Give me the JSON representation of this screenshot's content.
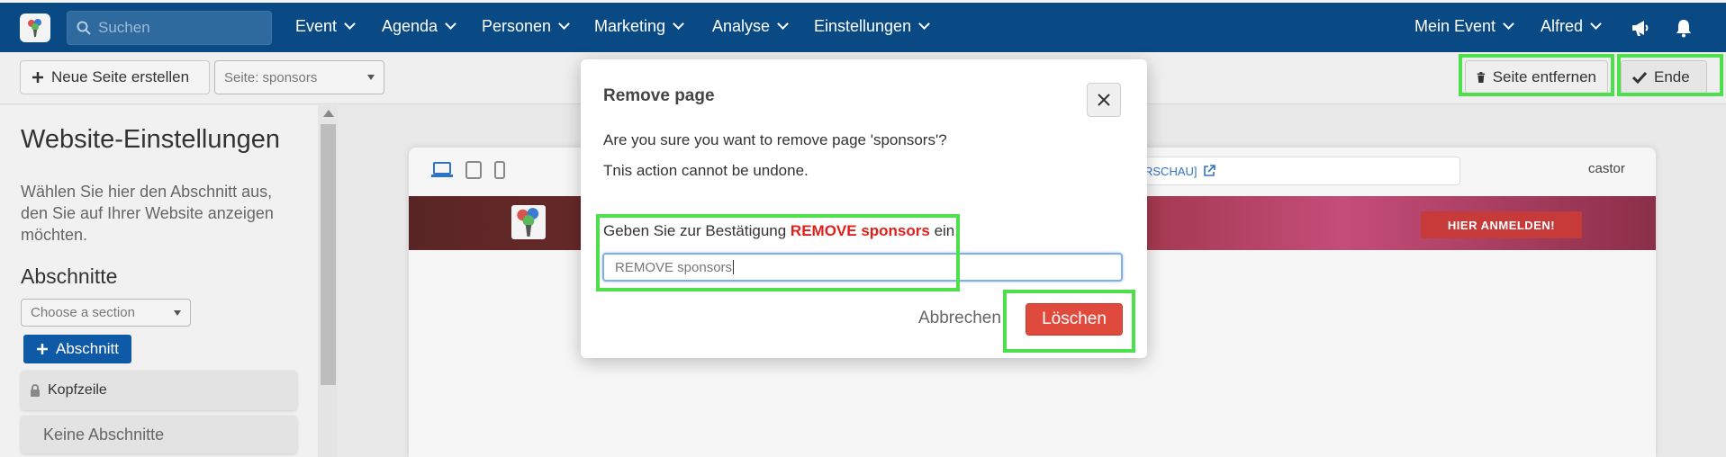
{
  "nav": {
    "search_placeholder": "Suchen",
    "items": [
      {
        "label": "Event"
      },
      {
        "label": "Agenda"
      },
      {
        "label": "Personen"
      },
      {
        "label": "Marketing"
      },
      {
        "label": "Analyse"
      },
      {
        "label": "Einstellungen"
      }
    ],
    "my_event": "Mein Event",
    "user": "Alfred",
    "icons": [
      "megaphone-icon",
      "bell-icon"
    ]
  },
  "toolbar": {
    "new_page": "Neue Seite erstellen",
    "page_select": "Seite: sponsors",
    "remove_page": "Seite entfernen",
    "end": "Ende"
  },
  "left": {
    "title": "Website-Einstellungen",
    "description": "Wählen Sie hier den Abschnitt aus, den Sie auf Ihrer Website anzeigen möchten.",
    "sections_heading": "Abschnitte",
    "section_select": "Choose a section",
    "add_section": "Abschnitt",
    "header_item": "Kopfzeile",
    "no_sections": "Keine Abschnitte"
  },
  "preview": {
    "url_fragment": "RSCHAU]",
    "castor": "castor",
    "register_button": "HIER ANMELDEN!"
  },
  "modal": {
    "title": "Remove page",
    "question": "Are you sure you want to remove page 'sponsors'?",
    "warning": "Tnis action cannot be undone.",
    "confirm_prefix": "Geben Sie zur Bestätigung ",
    "confirm_keyword": "REMOVE sponsors",
    "confirm_suffix": " ein:",
    "input_value": "REMOVE sponsors",
    "cancel": "Abbrechen",
    "delete": "Löschen"
  },
  "colors": {
    "nav_bg": "#0a4a84",
    "primary": "#0e5aa7",
    "danger": "#e04a3d",
    "highlight": "#4ee04a",
    "keyword": "#e0201a"
  }
}
